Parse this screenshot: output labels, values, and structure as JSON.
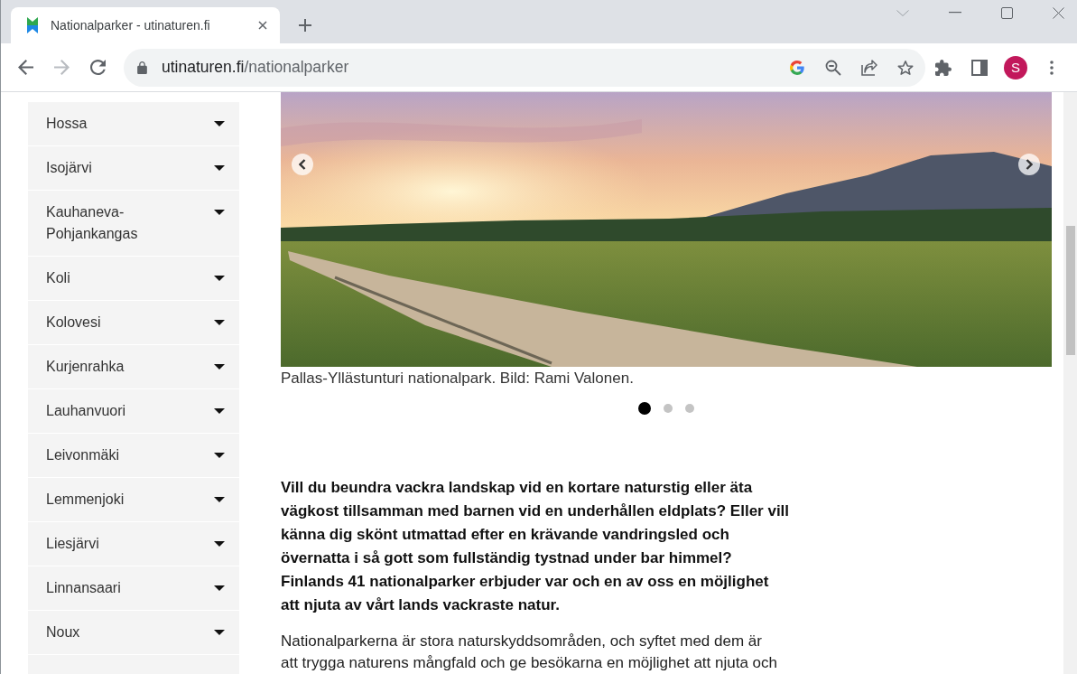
{
  "browser": {
    "tabs": [
      {
        "title": "Nationalparker - utinaturen.fi",
        "selected": true
      }
    ],
    "navigation": {
      "back_disabled": false,
      "forward_disabled": true
    },
    "address": {
      "host": "utinaturen.fi",
      "path": "/nationalparker"
    },
    "profile": {
      "initial": "S"
    }
  },
  "sidebar": {
    "items": [
      {
        "label": "Hossa"
      },
      {
        "label": "Isojärvi"
      },
      {
        "label": "Kauhaneva-Pohjankangas"
      },
      {
        "label": "Koli"
      },
      {
        "label": "Kolovesi"
      },
      {
        "label": "Kurjenrahka"
      },
      {
        "label": "Lauhanvuori"
      },
      {
        "label": "Leivonmäki"
      },
      {
        "label": "Lemmenjoki"
      },
      {
        "label": "Liesjärvi"
      },
      {
        "label": "Linnansaari"
      },
      {
        "label": "Noux"
      }
    ]
  },
  "carousel": {
    "caption": "Pallas-Yllästunturi nationalpark. Bild: Rami Valonen.",
    "dots": [
      {
        "selected": true
      },
      {
        "selected": false
      },
      {
        "selected": false
      }
    ]
  },
  "article": {
    "lead": "Vill du beundra vackra landskap vid en kortare naturstig eller äta vägkost tillsamman med barnen vid en underhållen eldplats? Eller vill känna dig skönt utmattad efter en krävande vandringsled och övernatta i så gott som fullständig tystnad under bar himmel? Finlands 41 nationalparker erbjuder var och en av oss en möjlighet att njuta av vårt lands vackraste natur.",
    "body": "Nationalparkerna är stora naturskyddsområden, och syftet med dem är att trygga naturens mångfald och ge besökarna en möjlighet att njuta och"
  }
}
